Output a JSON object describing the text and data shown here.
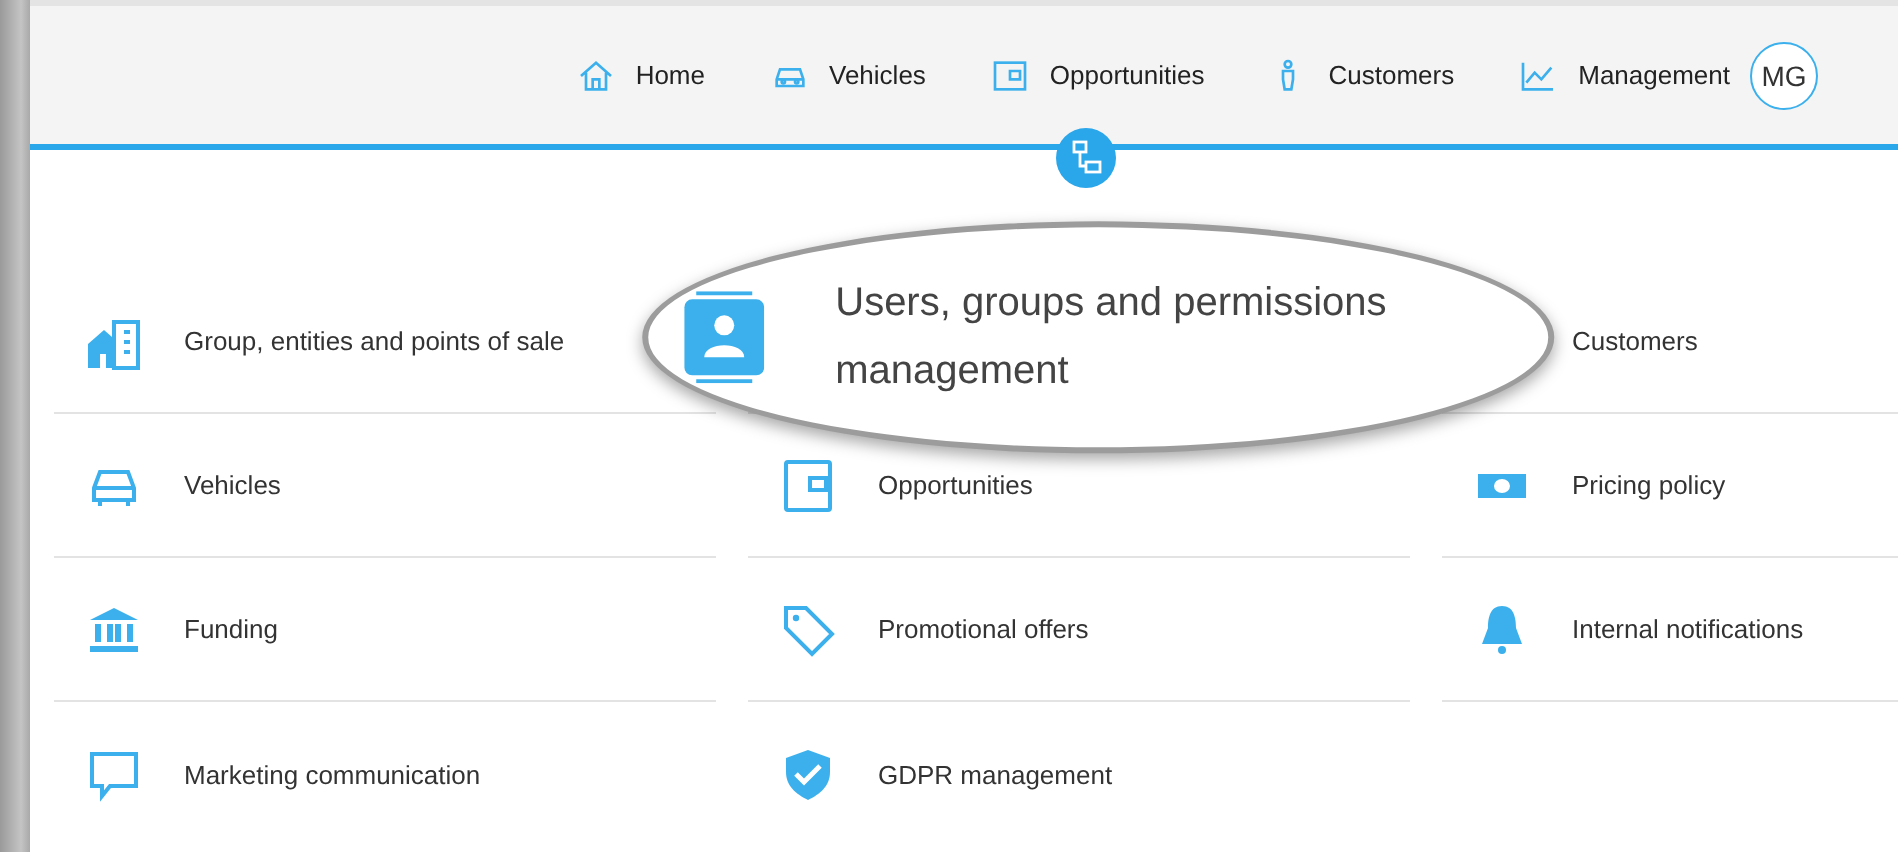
{
  "nav": {
    "items": [
      {
        "label": "Home"
      },
      {
        "label": "Vehicles"
      },
      {
        "label": "Opportunities"
      },
      {
        "label": "Customers"
      },
      {
        "label": "Management"
      }
    ],
    "avatar": "MG"
  },
  "settings": {
    "items": [
      {
        "label": "Group, entities and points of sale",
        "highlighted": false
      },
      {
        "label": "Users, groups and permissions management",
        "highlighted": true
      },
      {
        "label": "Customers",
        "highlighted": false
      },
      {
        "label": "Vehicles",
        "highlighted": false
      },
      {
        "label": "Opportunities",
        "highlighted": false
      },
      {
        "label": "Pricing policy",
        "highlighted": false
      },
      {
        "label": "Funding",
        "highlighted": false
      },
      {
        "label": "Promotional offers",
        "highlighted": false
      },
      {
        "label": "Internal notifications",
        "highlighted": false
      },
      {
        "label": "Marketing communication",
        "highlighted": false
      },
      {
        "label": "GDPR management",
        "highlighted": false
      }
    ]
  }
}
